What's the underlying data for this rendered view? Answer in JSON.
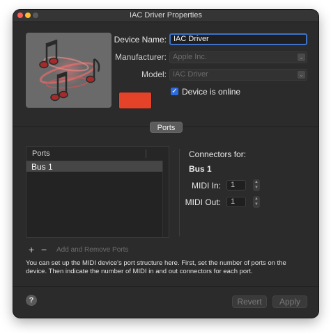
{
  "window": {
    "title": "IAC Driver Properties"
  },
  "colors": {
    "accent": "#3f72c6",
    "device_color": "#e4432a"
  },
  "device": {
    "name_label": "Device Name:",
    "name_value": "IAC Driver",
    "manufacturer_label": "Manufacturer:",
    "manufacturer_value": "Apple Inc.",
    "model_label": "Model:",
    "model_value": "IAC Driver",
    "online_label": "Device is online",
    "online_checked": true
  },
  "tabs": {
    "ports_label": "Ports"
  },
  "ports_table": {
    "header": "Ports",
    "rows": [
      "Bus 1"
    ]
  },
  "port_controls": {
    "add_remove_label": "Add and Remove Ports"
  },
  "connectors": {
    "heading": "Connectors for:",
    "port_name": "Bus 1",
    "midi_in_label": "MIDI In:",
    "midi_in_value": "1",
    "midi_out_label": "MIDI Out:",
    "midi_out_value": "1"
  },
  "help_text": "You can set up the MIDI device's port structure here. First, set the number of ports on the device. Then indicate the number of MIDI in and out connectors for each port.",
  "footer": {
    "help_glyph": "?",
    "revert_label": "Revert",
    "apply_label": "Apply"
  },
  "icons": [
    "close-light-icon",
    "minimize-light-icon",
    "zoom-light-icon",
    "midi-notes-icon",
    "checkmark-icon",
    "plus-icon",
    "minus-icon",
    "chevron-updown-icon",
    "help-icon"
  ]
}
